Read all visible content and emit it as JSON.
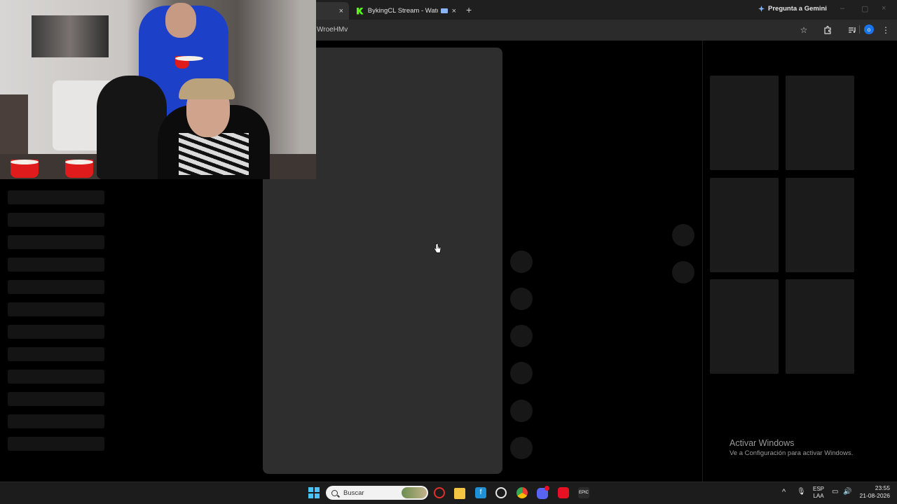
{
  "browser": {
    "tabs": [
      {
        "title": "",
        "active": true
      },
      {
        "title": "BykingCL Stream - Watch L",
        "active": false
      }
    ],
    "new_tab_symbol": "+",
    "close_symbol": "×",
    "gemini_label": "Pregunta a Gemini",
    "window_controls": [
      "–",
      "▢",
      "×"
    ],
    "url_fragment": "WroeHMv",
    "profile_initial": "o"
  },
  "watermark": {
    "title": "Activar Windows",
    "subtitle": "Ve a Configuración para activar Windows."
  },
  "taskbar": {
    "search_placeholder": "Buscar",
    "language": "ESP",
    "layout": "LAA",
    "time": "23:55",
    "date": "21-08-2026",
    "discord_badge": "9+"
  },
  "colors": {
    "kick_green": "#53fc18",
    "accent_blue": "#4cc2ff",
    "profile_blue": "#1a73e8"
  }
}
